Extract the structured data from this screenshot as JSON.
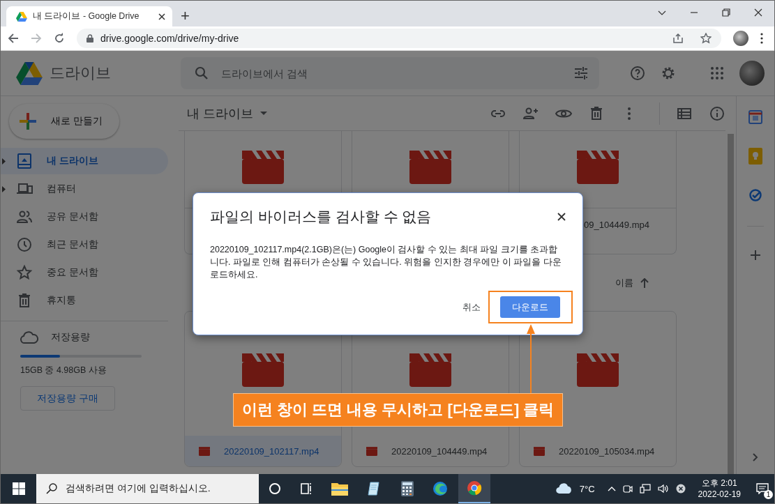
{
  "browser": {
    "tab": {
      "title": "내 드라이브 - Google Drive"
    },
    "new_tab": "+",
    "url": "drive.google.com/drive/my-drive"
  },
  "drive": {
    "app_name": "드라이브",
    "search": {
      "placeholder": "드라이브에서 검색"
    },
    "new_button": "새로 만들기",
    "nav": [
      {
        "label": "내 드라이브",
        "selected": true,
        "expandable": true
      },
      {
        "label": "컴퓨터",
        "selected": false,
        "expandable": true
      },
      {
        "label": "공유 문서함",
        "selected": false,
        "expandable": false
      },
      {
        "label": "최근 문서함",
        "selected": false,
        "expandable": false
      },
      {
        "label": "중요 문서함",
        "selected": false,
        "expandable": false
      },
      {
        "label": "휴지통",
        "selected": false,
        "expandable": false
      }
    ],
    "storage": {
      "label": "저장용량",
      "level": 0.33,
      "usage": "15GB 중 4.98GB 사용",
      "buy_button": "저장용량 구매"
    },
    "location": "내 드라이브",
    "sort": "이름",
    "files_top": [
      {
        "kind": "video"
      },
      {
        "kind": "video"
      },
      {
        "kind": "video",
        "name": "09_104449.mp4"
      }
    ],
    "files": [
      {
        "kind": "video",
        "name": "20220109_102117.mp4",
        "selected": true
      },
      {
        "kind": "video",
        "name": "20220109_104449.mp4",
        "selected": false
      },
      {
        "kind": "video",
        "name": "20220109_105034.mp4",
        "selected": false
      }
    ]
  },
  "dialog": {
    "title": "파일의 바이러스를 검사할 수 없음",
    "message": "20220109_102117.mp4(2.1GB)은(는) Google이 검사할 수 있는 최대 파일 크기를 초과합니다. 파일로 인해 컴퓨터가 손상될 수 있습니다. 위험을 인지한 경우에만 이 파일을 다운로드하세요.",
    "cancel": "취소",
    "confirm": "다운로드"
  },
  "annotation": {
    "text": "이런 창이 뜨면 내용 무시하고 [다운로드] 클릭"
  },
  "taskbar": {
    "search_placeholder": "검색하려면 여기에 입력하십시오.",
    "weather": "7°C",
    "time": "오후 2:01",
    "date": "2022-02-19",
    "notifications": "1"
  }
}
